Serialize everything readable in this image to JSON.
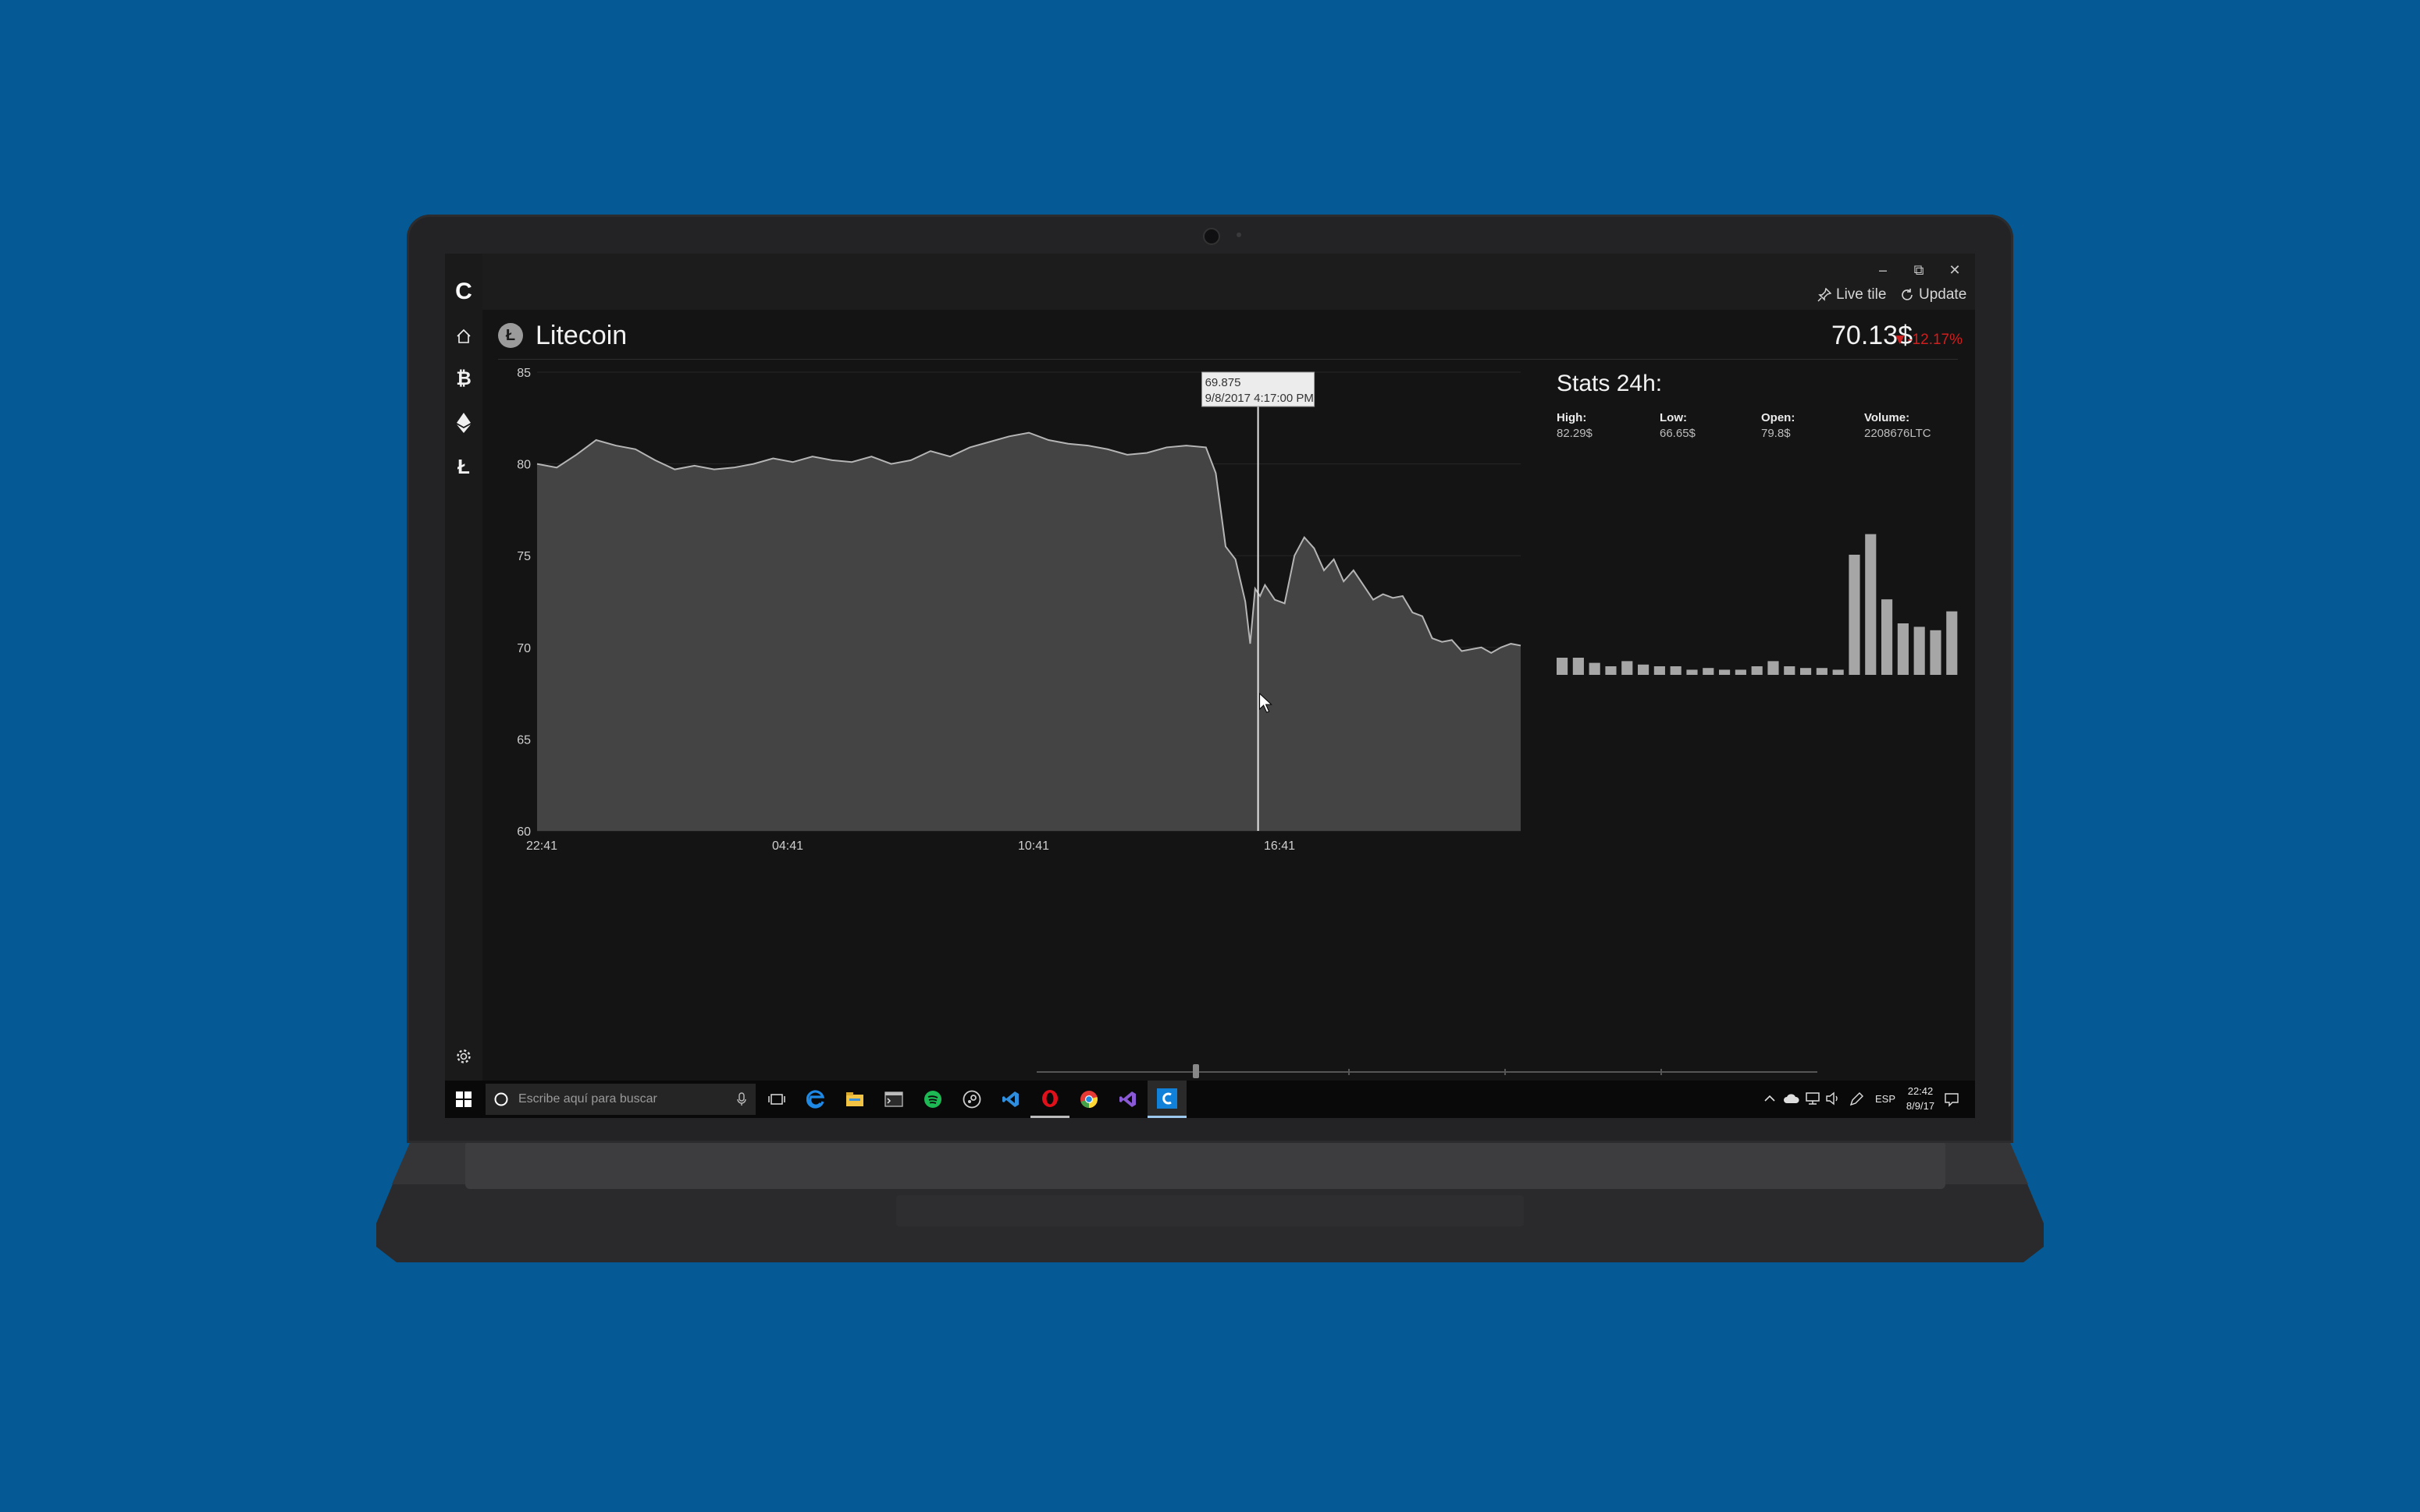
{
  "app": {
    "logo": "C",
    "window_controls": {
      "minimize": "–",
      "maximize": "⧉",
      "close": "✕"
    },
    "commands": {
      "live_tile": "Live tile",
      "update": "Update"
    }
  },
  "nav": {
    "items": [
      {
        "name": "home",
        "icon": "home-icon"
      },
      {
        "name": "bitcoin",
        "icon": "bitcoin-icon",
        "glyph": "₿"
      },
      {
        "name": "ethereum",
        "icon": "ethereum-icon"
      },
      {
        "name": "litecoin",
        "icon": "litecoin-icon",
        "glyph": "Ł"
      }
    ],
    "settings_icon": "gear-icon"
  },
  "coin": {
    "badge": "Ł",
    "name": "Litecoin",
    "price": "70.13$",
    "change": "▼-12.17%"
  },
  "tooltip": {
    "value": "69.875",
    "datetime": "9/8/2017 4:17:00 PM"
  },
  "chart_data": [
    {
      "type": "area",
      "title": "",
      "ylim": [
        60,
        85
      ],
      "yticks": [
        "85",
        "80",
        "75",
        "70",
        "65",
        "60"
      ],
      "xticks": [
        "22:41",
        "04:41",
        "10:41",
        "16:41"
      ],
      "x": [
        0,
        0.02,
        0.04,
        0.06,
        0.08,
        0.1,
        0.12,
        0.14,
        0.16,
        0.18,
        0.2,
        0.22,
        0.24,
        0.26,
        0.28,
        0.3,
        0.32,
        0.34,
        0.36,
        0.38,
        0.4,
        0.42,
        0.44,
        0.46,
        0.48,
        0.5,
        0.52,
        0.54,
        0.56,
        0.58,
        0.6,
        0.62,
        0.64,
        0.66,
        0.68,
        0.69,
        0.7,
        0.71,
        0.72,
        0.725,
        0.73,
        0.735,
        0.74,
        0.75,
        0.76,
        0.77,
        0.78,
        0.79,
        0.8,
        0.81,
        0.82,
        0.83,
        0.84,
        0.85,
        0.86,
        0.87,
        0.88,
        0.89,
        0.9,
        0.91,
        0.92,
        0.93,
        0.94,
        0.95,
        0.96,
        0.97,
        0.98,
        0.99,
        1.0
      ],
      "y": [
        80.0,
        79.8,
        80.5,
        81.3,
        81.0,
        80.8,
        80.2,
        79.7,
        79.9,
        79.7,
        79.8,
        80.0,
        80.3,
        80.1,
        80.4,
        80.2,
        80.1,
        80.4,
        80.0,
        80.2,
        80.7,
        80.4,
        80.9,
        81.2,
        81.5,
        81.7,
        81.3,
        81.1,
        81.0,
        80.8,
        80.5,
        80.6,
        80.9,
        81.0,
        80.9,
        79.5,
        75.5,
        74.8,
        72.5,
        70.2,
        73.2,
        72.8,
        73.4,
        72.6,
        72.4,
        75.0,
        76.0,
        75.4,
        74.2,
        74.8,
        73.6,
        74.2,
        73.4,
        72.6,
        72.9,
        72.7,
        72.8,
        71.9,
        71.7,
        70.5,
        70.3,
        70.4,
        69.8,
        69.9,
        70.0,
        69.7,
        70.0,
        70.2,
        70.1
      ],
      "cursor_x": 0.733
    },
    {
      "type": "bar",
      "title": "Stats 24h:",
      "values": [
        10,
        10,
        7,
        5,
        8,
        6,
        5,
        5,
        3,
        4,
        3,
        3,
        5,
        8,
        5,
        4,
        4,
        3,
        70,
        82,
        44,
        30,
        28,
        26,
        37
      ],
      "ylim": [
        0,
        90
      ]
    }
  ],
  "stats": {
    "title": "Stats 24h:",
    "high_label": "High:",
    "high_value": "82.29$",
    "low_label": "Low:",
    "low_value": "66.65$",
    "open_label": "Open:",
    "open_value": "79.8$",
    "volume_label": "Volume:",
    "volume_value": "2208676LTC"
  },
  "taskbar": {
    "search_placeholder": "Escribe aquí para buscar",
    "apps": [
      "task-view-icon",
      "edge-icon",
      "file-explorer-icon",
      "console-icon",
      "spotify-icon",
      "steam-icon",
      "vscode-icon",
      "opera-icon",
      "chrome-icon",
      "visual-studio-icon",
      "crypto-app-icon"
    ],
    "language": "ESP",
    "time": "22:42",
    "date": "8/9/17"
  },
  "colors": {
    "background": "#055a96",
    "app_bg": "#141414",
    "area_fill": "#444444",
    "line": "#b5b5b5",
    "change_red": "#d01e1e",
    "bar": "#a6a6a6"
  }
}
